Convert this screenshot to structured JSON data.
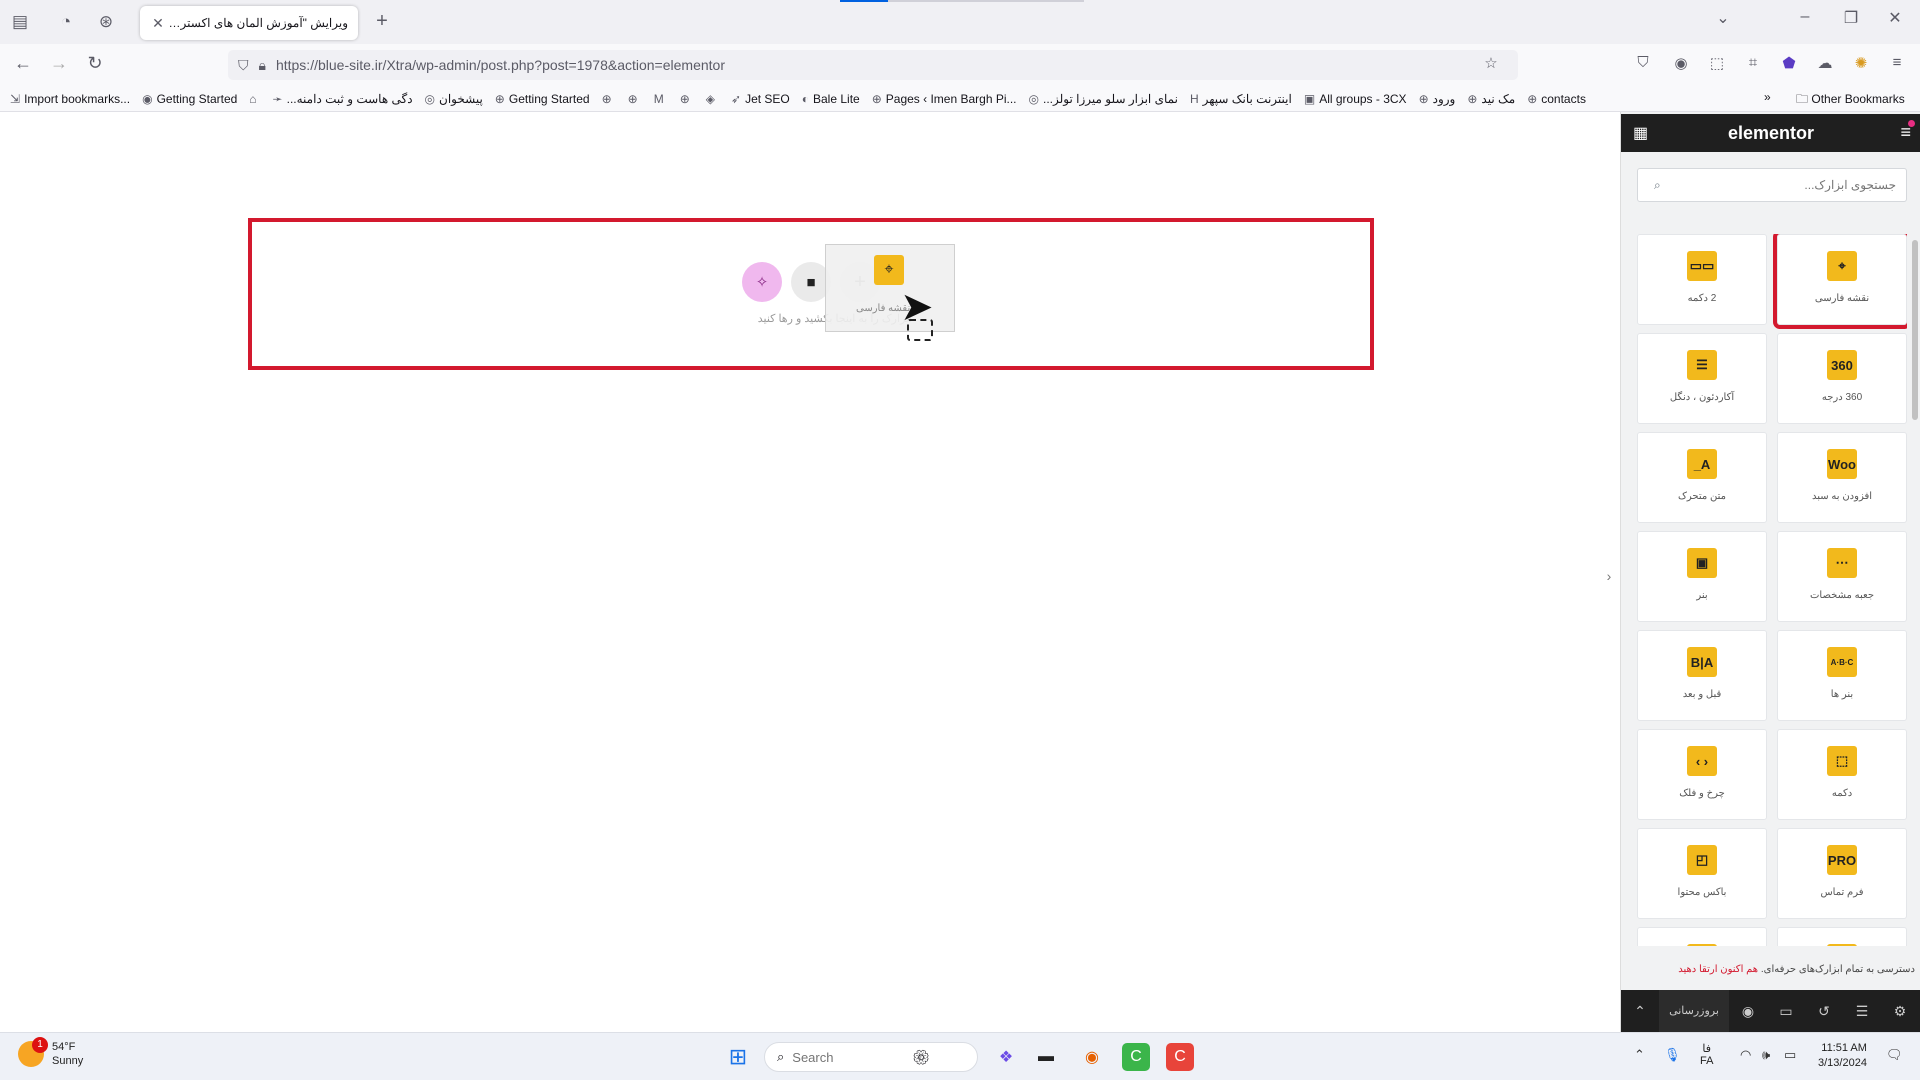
{
  "browser": {
    "tab_title": "ویرایش \"آموزش المان های اکسترا - ...",
    "url": "https://blue-site.ir/Xtra/wp-admin/post.php?post=1978&action=elementor",
    "bookmarks": [
      {
        "label": "Import bookmarks...",
        "icon": "import-icon"
      },
      {
        "label": "Getting Started",
        "icon": "firefox-icon"
      },
      {
        "label": "",
        "icon": "bank-icon"
      },
      {
        "label": "...دگی هاست و ثبت دامنه",
        "icon": "arrow-icon"
      },
      {
        "label": "پیشخوان",
        "icon": "wp-icon"
      },
      {
        "label": "Getting Started",
        "icon": "globe-icon"
      },
      {
        "label": "",
        "icon": "globe-icon"
      },
      {
        "label": "",
        "icon": "globe-icon"
      },
      {
        "label": "",
        "icon": "gmail-icon"
      },
      {
        "label": "",
        "icon": "globe-icon"
      },
      {
        "label": "",
        "icon": "shield-icon"
      },
      {
        "label": "Jet SEO",
        "icon": "rocket-icon"
      },
      {
        "label": "Bale Lite",
        "icon": "bale-icon"
      },
      {
        "label": "Pages ‹ Imen Bargh Pi...",
        "icon": "globe-icon"
      },
      {
        "label": "...نمای ابزار سلو میرزا تولز",
        "icon": "wp-icon"
      },
      {
        "label": "اینترنت بانک سپهر",
        "icon": "h-icon"
      },
      {
        "label": "All groups - 3CX",
        "icon": "3cx-icon"
      },
      {
        "label": "ورود",
        "icon": "globe-icon"
      },
      {
        "label": "مک نید",
        "icon": "globe-icon"
      },
      {
        "label": "contacts",
        "icon": "globe-icon"
      }
    ],
    "other_bookmarks": "Other Bookmarks"
  },
  "canvas": {
    "drop_hint": "ابزارک را به اینجا بکشید و رها کنید",
    "drag_label": "نقشه فارسی"
  },
  "panel": {
    "logo": "elementor",
    "search_placeholder": "جستجوی ابزارک...",
    "widgets": [
      {
        "label": "نقشه فارسی",
        "icon_text": "⌖",
        "icon": "map-pin-icon",
        "selected": true
      },
      {
        "label": "2 دکمه",
        "icon_text": "▭▭",
        "icon": "dual-button-icon"
      },
      {
        "label": "360 درجه",
        "icon_text": "360",
        "icon": "360-icon"
      },
      {
        "label": "آکاردئون ، دنگل",
        "icon_text": "☰",
        "icon": "accordion-icon"
      },
      {
        "label": "افزودن به سبد",
        "icon_text": "Woo",
        "icon": "woo-icon"
      },
      {
        "label": "متن متحرک",
        "icon_text": "A_",
        "icon": "animated-text-icon"
      },
      {
        "label": "جعبه مشخصات",
        "icon_text": "⋯",
        "icon": "info-box-icon"
      },
      {
        "label": "بنر",
        "icon_text": "▣",
        "icon": "banner-icon"
      },
      {
        "label": "بنر ها",
        "icon_text": "A·B·C",
        "icon": "banners-icon"
      },
      {
        "label": "قبل و بعد",
        "icon_text": "B|A",
        "icon": "before-after-icon"
      },
      {
        "label": "دکمه",
        "icon_text": "⬚",
        "icon": "button-icon"
      },
      {
        "label": "چرخ و فلک",
        "icon_text": "‹ ›",
        "icon": "carousel-icon"
      },
      {
        "label": "فرم تماس",
        "icon_text": "PRO",
        "icon": "contact-form-icon"
      },
      {
        "label": "باکس محتوا",
        "icon_text": "◰",
        "icon": "content-box-icon"
      },
      {
        "label": "",
        "icon_text": "",
        "icon": "partial-widget-icon"
      },
      {
        "label": "",
        "icon_text": "",
        "icon": "partial-widget-icon"
      }
    ],
    "promo_text": "دسترسی به تمام ابزارک‌های حرفه‌ای.",
    "promo_link": "هم اکنون ارتقا دهید",
    "publish_label": "بروزرسانی"
  },
  "taskbar": {
    "weather_temp": "54°F",
    "weather_desc": "Sunny",
    "weather_badge": "1",
    "search_placeholder": "Search",
    "lang_top": "فا",
    "lang_bottom": "FA",
    "time": "11:51 AM",
    "date": "3/13/2024"
  }
}
